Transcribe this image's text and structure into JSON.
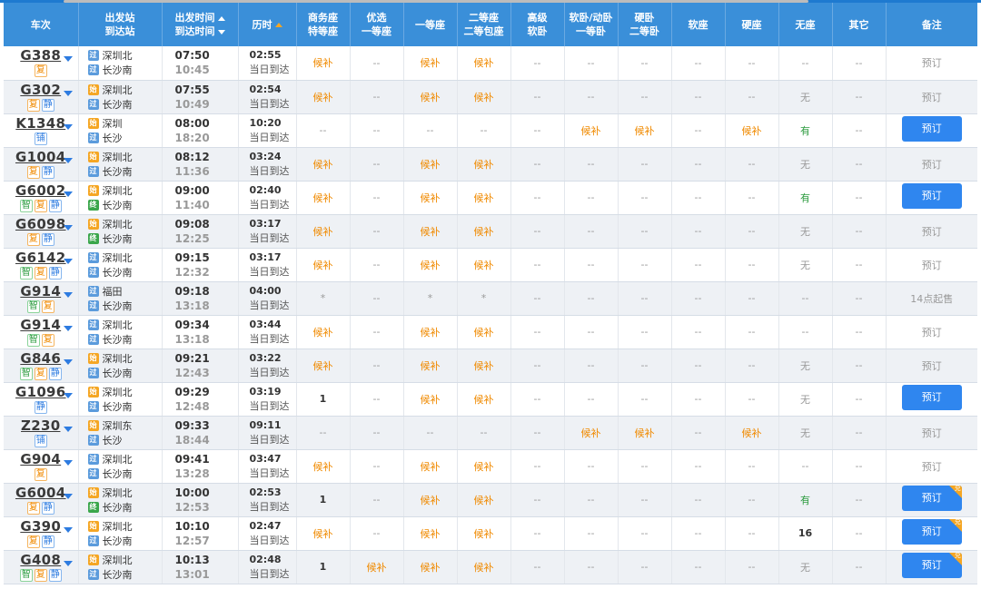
{
  "columns": {
    "train": "车次",
    "station_top": "出发站",
    "station_bot": "到达站",
    "time_top": "出发时间",
    "time_bot": "到达时间",
    "duration": "历时",
    "business": [
      "商务座",
      "特等座"
    ],
    "premium": [
      "优选",
      "一等座"
    ],
    "first": "一等座",
    "second": [
      "二等座",
      "二等包座"
    ],
    "adv_soft": [
      "高级",
      "软卧"
    ],
    "soft": [
      "软卧/动卧",
      "一等卧"
    ],
    "hard_sleeper": [
      "硬卧",
      "二等卧"
    ],
    "soft_seat": "软座",
    "hard_seat": "硬座",
    "no_seat": "无座",
    "other": "其它",
    "remark": "备注"
  },
  "rows": [
    {
      "train": "G388",
      "tags": [
        "复"
      ],
      "from": "深圳北",
      "from_badge": "过",
      "to": "长沙南",
      "to_badge": "过",
      "dep": "07:50",
      "arr": "10:45",
      "dur": "02:55",
      "arr_day": "当日到达",
      "seats": [
        "候补",
        "--",
        "候补",
        "候补",
        "--",
        "--",
        "--",
        "--",
        "--",
        "--",
        "--"
      ],
      "remark": "预订",
      "remark_type": "text",
      "dui": false
    },
    {
      "train": "G302",
      "tags": [
        "复",
        "静"
      ],
      "from": "深圳北",
      "from_badge": "始",
      "to": "长沙南",
      "to_badge": "过",
      "dep": "07:55",
      "arr": "10:49",
      "dur": "02:54",
      "arr_day": "当日到达",
      "seats": [
        "候补",
        "--",
        "候补",
        "候补",
        "--",
        "--",
        "--",
        "--",
        "--",
        "无",
        "--"
      ],
      "remark": "预订",
      "remark_type": "text",
      "dui": false
    },
    {
      "train": "K1348",
      "tags": [
        "铺"
      ],
      "from": "深圳",
      "from_badge": "始",
      "to": "长沙",
      "to_badge": "过",
      "dep": "08:00",
      "arr": "18:20",
      "dur": "10:20",
      "arr_day": "当日到达",
      "seats": [
        "--",
        "--",
        "--",
        "--",
        "--",
        "候补",
        "候补",
        "--",
        "候补",
        "有",
        "--"
      ],
      "remark": "预订",
      "remark_type": "button",
      "dui": false
    },
    {
      "train": "G1004",
      "tags": [
        "复",
        "静"
      ],
      "from": "深圳北",
      "from_badge": "始",
      "to": "长沙南",
      "to_badge": "过",
      "dep": "08:12",
      "arr": "11:36",
      "dur": "03:24",
      "arr_day": "当日到达",
      "seats": [
        "候补",
        "--",
        "候补",
        "候补",
        "--",
        "--",
        "--",
        "--",
        "--",
        "无",
        "--"
      ],
      "remark": "预订",
      "remark_type": "text",
      "dui": false
    },
    {
      "train": "G6002",
      "tags": [
        "智",
        "复",
        "静"
      ],
      "from": "深圳北",
      "from_badge": "始",
      "to": "长沙南",
      "to_badge": "终",
      "dep": "09:00",
      "arr": "11:40",
      "dur": "02:40",
      "arr_day": "当日到达",
      "seats": [
        "候补",
        "--",
        "候补",
        "候补",
        "--",
        "--",
        "--",
        "--",
        "--",
        "有",
        "--"
      ],
      "remark": "预订",
      "remark_type": "button",
      "dui": false
    },
    {
      "train": "G6098",
      "tags": [
        "复",
        "静"
      ],
      "from": "深圳北",
      "from_badge": "始",
      "to": "长沙南",
      "to_badge": "终",
      "dep": "09:08",
      "arr": "12:25",
      "dur": "03:17",
      "arr_day": "当日到达",
      "seats": [
        "候补",
        "--",
        "候补",
        "候补",
        "--",
        "--",
        "--",
        "--",
        "--",
        "无",
        "--"
      ],
      "remark": "预订",
      "remark_type": "text",
      "dui": false
    },
    {
      "train": "G6142",
      "tags": [
        "智",
        "复",
        "静"
      ],
      "from": "深圳北",
      "from_badge": "过",
      "to": "长沙南",
      "to_badge": "过",
      "dep": "09:15",
      "arr": "12:32",
      "dur": "03:17",
      "arr_day": "当日到达",
      "seats": [
        "候补",
        "--",
        "候补",
        "候补",
        "--",
        "--",
        "--",
        "--",
        "--",
        "无",
        "--"
      ],
      "remark": "预订",
      "remark_type": "text",
      "dui": false
    },
    {
      "train": "G914",
      "tags": [
        "智",
        "复"
      ],
      "from": "福田",
      "from_badge": "过",
      "to": "长沙南",
      "to_badge": "过",
      "dep": "09:18",
      "arr": "13:18",
      "dur": "04:00",
      "arr_day": "当日到达",
      "seats": [
        "*",
        "--",
        "*",
        "*",
        "--",
        "--",
        "--",
        "--",
        "--",
        "--",
        "--"
      ],
      "remark": "14点起售",
      "remark_type": "text",
      "dui": false
    },
    {
      "train": "G914",
      "tags": [
        "智",
        "复"
      ],
      "from": "深圳北",
      "from_badge": "过",
      "to": "长沙南",
      "to_badge": "过",
      "dep": "09:34",
      "arr": "13:18",
      "dur": "03:44",
      "arr_day": "当日到达",
      "seats": [
        "候补",
        "--",
        "候补",
        "候补",
        "--",
        "--",
        "--",
        "--",
        "--",
        "--",
        "--"
      ],
      "remark": "预订",
      "remark_type": "text",
      "dui": false
    },
    {
      "train": "G846",
      "tags": [
        "智",
        "复",
        "静"
      ],
      "from": "深圳北",
      "from_badge": "始",
      "to": "长沙南",
      "to_badge": "过",
      "dep": "09:21",
      "arr": "12:43",
      "dur": "03:22",
      "arr_day": "当日到达",
      "seats": [
        "候补",
        "--",
        "候补",
        "候补",
        "--",
        "--",
        "--",
        "--",
        "--",
        "无",
        "--"
      ],
      "remark": "预订",
      "remark_type": "text",
      "dui": false
    },
    {
      "train": "G1096",
      "tags": [
        "静"
      ],
      "from": "深圳北",
      "from_badge": "始",
      "to": "长沙南",
      "to_badge": "过",
      "dep": "09:29",
      "arr": "12:48",
      "dur": "03:19",
      "arr_day": "当日到达",
      "seats": [
        "1",
        "--",
        "候补",
        "候补",
        "--",
        "--",
        "--",
        "--",
        "--",
        "无",
        "--"
      ],
      "remark": "预订",
      "remark_type": "button",
      "dui": false
    },
    {
      "train": "Z230",
      "tags": [
        "铺"
      ],
      "from": "深圳东",
      "from_badge": "始",
      "to": "长沙",
      "to_badge": "过",
      "dep": "09:33",
      "arr": "18:44",
      "dur": "09:11",
      "arr_day": "当日到达",
      "seats": [
        "--",
        "--",
        "--",
        "--",
        "--",
        "候补",
        "候补",
        "--",
        "候补",
        "无",
        "--"
      ],
      "remark": "预订",
      "remark_type": "text",
      "dui": false
    },
    {
      "train": "G904",
      "tags": [
        "复"
      ],
      "from": "深圳北",
      "from_badge": "过",
      "to": "长沙南",
      "to_badge": "过",
      "dep": "09:41",
      "arr": "13:28",
      "dur": "03:47",
      "arr_day": "当日到达",
      "seats": [
        "候补",
        "--",
        "候补",
        "候补",
        "--",
        "--",
        "--",
        "--",
        "--",
        "--",
        "--"
      ],
      "remark": "预订",
      "remark_type": "text",
      "dui": false
    },
    {
      "train": "G6004",
      "tags": [
        "复",
        "静"
      ],
      "from": "深圳北",
      "from_badge": "始",
      "to": "长沙南",
      "to_badge": "终",
      "dep": "10:00",
      "arr": "12:53",
      "dur": "02:53",
      "arr_day": "当日到达",
      "seats": [
        "1",
        "--",
        "候补",
        "候补",
        "--",
        "--",
        "--",
        "--",
        "--",
        "有",
        "--"
      ],
      "remark": "预订",
      "remark_type": "button",
      "dui": true
    },
    {
      "train": "G390",
      "tags": [
        "复",
        "静"
      ],
      "from": "深圳北",
      "from_badge": "始",
      "to": "长沙南",
      "to_badge": "过",
      "dep": "10:10",
      "arr": "12:57",
      "dur": "02:47",
      "arr_day": "当日到达",
      "seats": [
        "候补",
        "--",
        "候补",
        "候补",
        "--",
        "--",
        "--",
        "--",
        "--",
        "16",
        "--"
      ],
      "remark": "预订",
      "remark_type": "button",
      "dui": true
    },
    {
      "train": "G408",
      "tags": [
        "智",
        "复",
        "静"
      ],
      "from": "深圳北",
      "from_badge": "始",
      "to": "长沙南",
      "to_badge": "过",
      "dep": "10:13",
      "arr": "13:01",
      "dur": "02:48",
      "arr_day": "当日到达",
      "seats": [
        "1",
        "候补",
        "候补",
        "候补",
        "--",
        "--",
        "--",
        "--",
        "--",
        "无",
        "--"
      ],
      "remark": "预订",
      "remark_type": "button",
      "dui": true
    }
  ],
  "dui_label": "兑",
  "colors": {
    "header": "#3a8fd9",
    "button": "#2f86ef",
    "waitlist": "#f08a00",
    "available": "#2c9b3f"
  }
}
